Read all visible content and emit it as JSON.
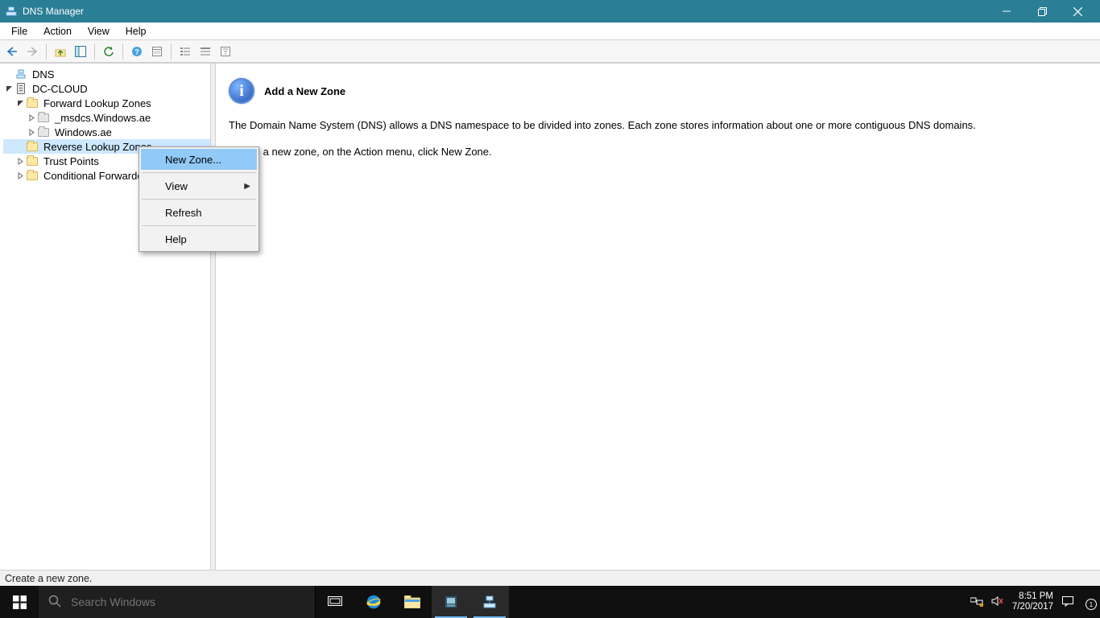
{
  "window": {
    "title": "DNS Manager",
    "min_tip": "Minimize",
    "max_tip": "Restore",
    "close_tip": "Close"
  },
  "menubar": {
    "file": "File",
    "action": "Action",
    "view": "View",
    "help": "Help"
  },
  "tree": {
    "root": "DNS",
    "server": "DC-CLOUD",
    "flz": "Forward Lookup Zones",
    "msdcs": "_msdcs.Windows.ae",
    "winae": "Windows.ae",
    "rlz": "Reverse Lookup Zones",
    "trust": "Trust Points",
    "cond": "Conditional Forwarders"
  },
  "content": {
    "heading": "Add a New Zone",
    "para1": "The Domain Name System (DNS) allows a DNS namespace to be divided into zones. Each zone stores information about one or more contiguous DNS domains.",
    "para2": "To add a new zone, on the Action menu, click New Zone."
  },
  "context_menu": {
    "new_zone": "New Zone...",
    "view": "View",
    "refresh": "Refresh",
    "help": "Help"
  },
  "statusbar": {
    "text": "Create a new zone."
  },
  "taskbar": {
    "search_placeholder": "Search Windows",
    "time": "8:51 PM",
    "date": "7/20/2017"
  }
}
